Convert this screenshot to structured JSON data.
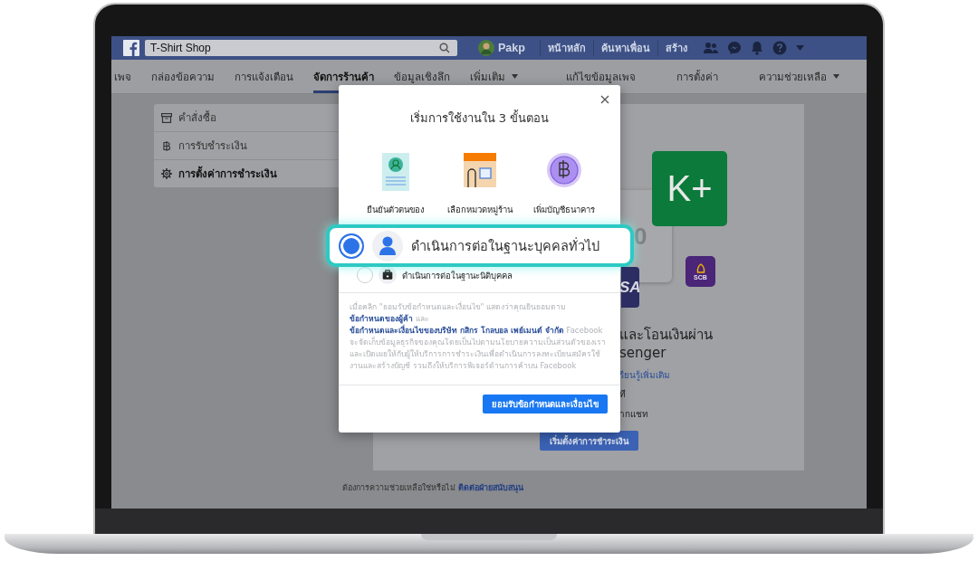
{
  "top_bar": {
    "search": {
      "value": "T-Shirt Shop"
    },
    "profile_name": "Pakp",
    "links": [
      "หน้าหลัก",
      "ค้นหาเพื่อน",
      "สร้าง"
    ]
  },
  "page_tabs": [
    {
      "label": "เพจ",
      "selected": false,
      "dropdown": false
    },
    {
      "label": "กล่องข้อความ",
      "selected": false,
      "dropdown": false
    },
    {
      "label": "การแจ้งเตือน",
      "selected": false,
      "dropdown": false
    },
    {
      "label": "จัดการร้านค้า",
      "selected": true,
      "dropdown": false
    },
    {
      "label": "ข้อมูลเชิงลึก",
      "selected": false,
      "dropdown": false
    },
    {
      "label": "เพิ่มเติม",
      "selected": false,
      "dropdown": true
    }
  ],
  "right_tabs": [
    {
      "label": "แก้ไขข้อมูลเพจ",
      "dropdown": false
    },
    {
      "label": "การตั้งค่า",
      "dropdown": false
    },
    {
      "label": "ความช่วยเหลือ",
      "dropdown": true
    }
  ],
  "sidebar": {
    "items": [
      {
        "label": "คำสั่งซื้อ",
        "selected": false
      },
      {
        "label": "การรับชำระเงิน",
        "selected": false
      },
      {
        "label": "การตั้งค่าการชำระเงิน",
        "selected": true
      }
    ]
  },
  "main_card": {
    "bank_tiles": [
      {
        "label": "K+",
        "color": "#0b7a3a"
      },
      {
        "label": "SCB",
        "color": "#4a2578"
      }
    ],
    "card_fragment": "0",
    "visa_fragment": "SA",
    "heading_lines": [
      "และโอนเงินผ่าน",
      "senger"
    ],
    "learn_more_link": "รียนรู้เพิ่มเติม",
    "lines": [
      "ที",
      "ากแชท"
    ],
    "button": "เริ่มตั้งค่าการชำระเงิน"
  },
  "footer": {
    "text": "ต้องการความช่วยเหลือใช่หรือไม่",
    "link": "ติดต่อฝ่ายสนับสนุน"
  },
  "modal": {
    "title": "เริ่มการใช้งานใน 3 ขั้นตอน",
    "steps": [
      {
        "label": "ยืนยันตัวตนของ"
      },
      {
        "label": "เลือกหมวดหมู่ร้าน"
      },
      {
        "label": "เพิ่มบัญชีธนาคาร"
      }
    ],
    "options": [
      {
        "kind": "callout",
        "label": "ดำเนินการต่อในฐานะบุคคลทั่วไป",
        "selected": true
      },
      {
        "kind": "plain",
        "label": "ดำเนินการต่อในฐานะนิติบุคคล",
        "selected": false
      }
    ],
    "notice": [
      {
        "text": "เมื่อคลิก \"ยอมรับข้อกำหนดและเงื่อนไข\" แสดงว่าคุณยินยอมตาม",
        "link": false
      },
      {
        "text": "ข้อกำหนดของผู้ค้า",
        "link": true
      },
      {
        "text": " และ",
        "link": false
      },
      {
        "text": "ข้อกำหนดและเงื่อนไขของบริษัท กสิกร โกลบอล เพย์เมนต์ จำกัด",
        "link": true
      },
      {
        "text": " Facebook จะจัดเก็บข้อมูลธุรกิจของคุณโดยเป็นไปตามนโยบายความเป็นส่วนตัวของเรา และเปิดเผยให้กับผู้ให้บริการการชำระเงินเพื่อดำเนินการลงทะเบียนสมัครใช้งานและสร้างบัญชี รวมถึงให้บริการฟีเจอร์ด้านการค้าบน Facebook",
        "link": false
      }
    ],
    "accept_button": "ยอมรับข้อกำหนดและเงื่อนไข"
  }
}
